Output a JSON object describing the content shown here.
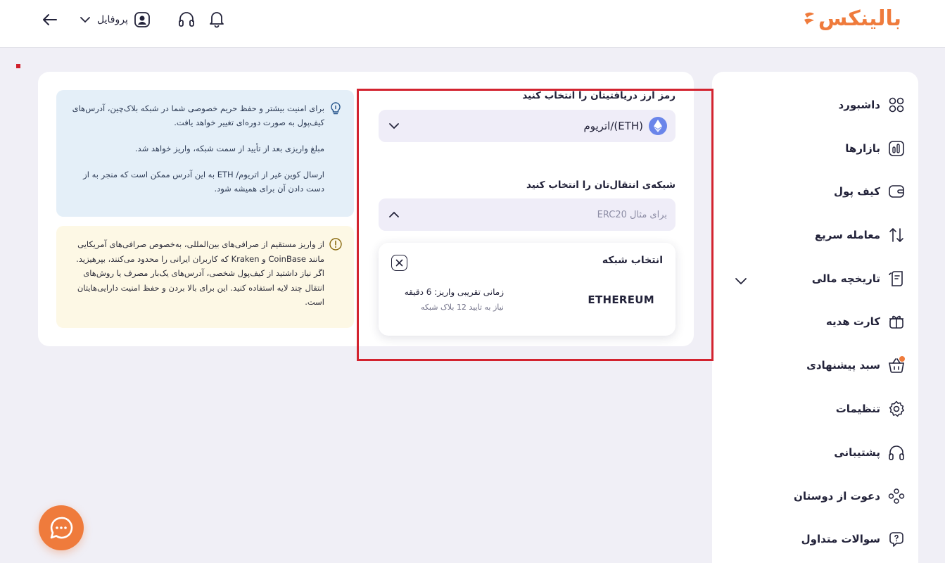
{
  "header": {
    "logo_text": "بالینکس",
    "profile_label": "پروفایل",
    "icons": {
      "back": "arrow-left-icon",
      "profile_dropdown": "chevron-down-icon",
      "profile": "user-icon",
      "support": "headset-icon",
      "notifications": "bell-icon"
    }
  },
  "sidebar": {
    "items": [
      {
        "label": "داشبورد",
        "icon": "grid-icon"
      },
      {
        "label": "بازارها",
        "icon": "chart-bars-icon"
      },
      {
        "label": "کیف پول",
        "icon": "wallet-icon"
      },
      {
        "label": "معامله سریع",
        "icon": "swap-arrows-icon"
      },
      {
        "label": "تاریخچه مالی",
        "icon": "receipt-icon"
      },
      {
        "label": "کارت هدیه",
        "icon": "gift-icon"
      },
      {
        "label": "سبد پیشنهادی",
        "icon": "basket-icon"
      },
      {
        "label": "تنظیمات",
        "icon": "settings-icon"
      },
      {
        "label": "پشتیبانی",
        "icon": "headset-icon"
      },
      {
        "label": "دعوت از دوستان",
        "icon": "users-icon"
      },
      {
        "label": "سوالات متداول",
        "icon": "question-icon"
      }
    ]
  },
  "info_box": {
    "paragraphs": [
      "برای امنیت بیشتر و حفظ حریم خصوصی شما در شبکه بلاک‌چین، آدرس‌های کیف‌پول به صورت دوره‌ای تغییر خواهد یافت.",
      "مبلغ واریزی بعد از تأیید از سمت شبکه، واریز خواهد شد.",
      "ارسال کوین غیر از اتریوم/ ETH به این آدرس ممکن است که منجر به از دست دادن آن برای همیشه شود."
    ]
  },
  "warning_box": {
    "text": "از واریز مستقیم از صرافی‌های بین‌المللی، به‌خصوص صرافی‌های آمریکایی مانند CoinBase و Kraken که کاربران ایرانی را محدود می‌کنند، بپرهیزید. اگر نیاز داشتید از کیف‌پول شخصی، آدرس‌های یک‌بار مصرف یا روش‌های انتقال چند لایه استفاده کنید. این برای بالا بردن و حفظ امنیت دارایی‌هایتان است."
  },
  "form": {
    "coin_label": "رمز ارز دریافتیتان را انتخاب کنید",
    "coin_value": "اتریوم/(ETH)",
    "network_label": "شبکه‌ی انتقال‌تان را انتخاب کنید",
    "network_placeholder": "برای مثال ERC20"
  },
  "network_panel": {
    "title": "انتخاب شبکه",
    "networks": [
      {
        "name": "ETHEREUM",
        "deposit_time": "زمانی تقریبی واریز: 6 دقیقه",
        "confirmations": "نیاز به تایید 12 بلاک شبکه"
      }
    ]
  },
  "colors": {
    "brand": "#ef7b3c",
    "highlight": "#d3232f",
    "info_bg": "#e4eff8",
    "warning_bg": "#fdf8e5"
  }
}
